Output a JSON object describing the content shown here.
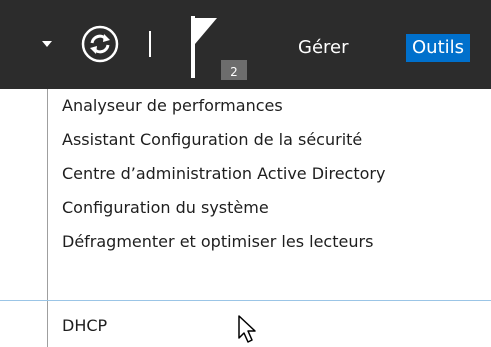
{
  "toolbar": {
    "arrow_icon": "chevron-down-icon",
    "refresh_icon": "refresh-icon",
    "flag_icon": "flag-icon",
    "notification_count": "2",
    "menu_gerer": "Gérer",
    "menu_outils": "Outils",
    "background_color": "#2c2c2c",
    "active_menu_color": "#0070cc"
  },
  "dropdown": {
    "items": [
      {
        "label": "Analyseur de performances"
      },
      {
        "label": "Assistant Configuration de la sécurité"
      },
      {
        "label": "Centre d’administration Active Directory"
      },
      {
        "label": "Configuration du système"
      },
      {
        "label": "Défragmenter et optimiser les lecteurs"
      },
      {
        "label": "DHCP"
      }
    ],
    "hovered_item": "DHCP",
    "hover_border_color": "#9bc5e6"
  },
  "cursor_icon": "mouse-pointer-icon"
}
